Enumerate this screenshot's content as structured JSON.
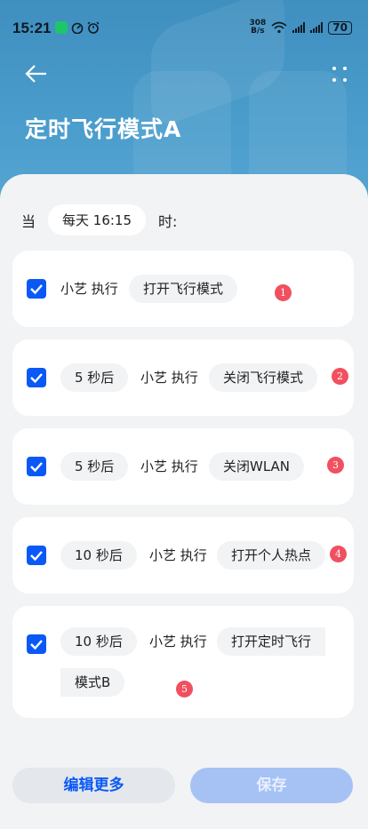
{
  "status_bar": {
    "time": "15:21",
    "net_speed_value": "308",
    "net_speed_unit": "B/s",
    "battery": "70"
  },
  "header": {
    "title": "定时飞行模式A"
  },
  "trigger": {
    "prefix": "当",
    "schedule": "每天 16:15",
    "suffix": "时:"
  },
  "actions": [
    {
      "delay": "",
      "actor": "小艺 执行",
      "action": "打开飞行模式",
      "badge": "1",
      "checked": true
    },
    {
      "delay": "5 秒后",
      "actor": "小艺 执行",
      "action": "关闭飞行模式",
      "badge": "2",
      "checked": true
    },
    {
      "delay": "5 秒后",
      "actor": "小艺 执行",
      "action": "关闭WLAN",
      "badge": "3",
      "checked": true
    },
    {
      "delay": "10 秒后",
      "actor": "小艺 执行",
      "action": "打开个人热点",
      "badge": "4",
      "checked": true
    },
    {
      "delay": "10 秒后",
      "actor": "小艺 执行",
      "action": "打开定时飞行",
      "action_cont": "模式B",
      "badge": "5",
      "checked": true
    }
  ],
  "footer": {
    "edit_label": "编辑更多",
    "save_label": "保存"
  },
  "colors": {
    "accent": "#0a59f7",
    "header": "#4a9dcc",
    "badge": "#f0505f"
  }
}
